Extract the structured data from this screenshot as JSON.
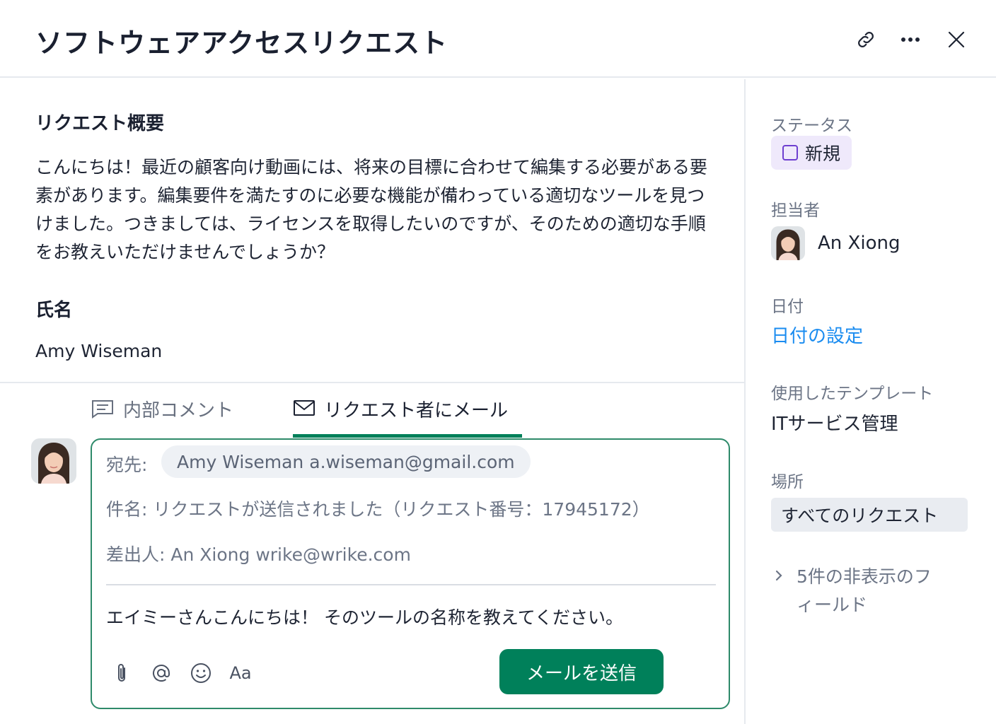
{
  "header": {
    "title": "ソフトウェアアクセスリクエスト",
    "icons": [
      "link-icon",
      "more-icon",
      "close-icon"
    ]
  },
  "request": {
    "summary_label": "リクエスト概要",
    "summary_text": "こんにちは！最近の顧客向け動画には、将来の目標に合わせて編集する必要がある要素があります。編集要件を満たすのに必要な機能が備わっている適切なツールを見つけました。つきましては、ライセンスを取得したいのですが、そのための適切な手順をお教えいただけませんでしょうか？",
    "name_label": "氏名",
    "name_value": "Amy Wiseman"
  },
  "tabs": [
    {
      "label": "内部コメント",
      "icon": "comment-icon",
      "active": false
    },
    {
      "label": "リクエスト者にメール",
      "icon": "mail-icon",
      "active": true
    }
  ],
  "composer": {
    "to_label": "宛先:",
    "to_name": "Amy Wiseman",
    "to_email": "a.wiseman@gmail.com",
    "subject_label": "件名:",
    "subject_value": "リクエストが送信されました（リクエスト番号：17945172）",
    "from_label": "差出人:",
    "from_value": "An Xiong wrike@wrike.com",
    "body": "エイミーさんこんにちは！ そのツールの名称を教えてください。",
    "tools": [
      "paperclip-icon",
      "at-icon",
      "emoji-icon",
      "text-format-icon"
    ],
    "format_label": "Aa",
    "send_label": "メールを送信"
  },
  "sidebar": {
    "status_label": "ステータス",
    "status_value": "新規",
    "status_color": "#6e3fd0",
    "assignee_label": "担当者",
    "assignee_name": "An Xiong",
    "date_label": "日付",
    "date_link": "日付の設定",
    "template_label": "使用したテンプレート",
    "template_value": "ITサービス管理",
    "location_label": "場所",
    "location_value": "すべてのリクエスト",
    "hidden_fields": "5件の非表示のフィールド"
  },
  "colors": {
    "accent": "#00805a",
    "link": "#1a8cf0",
    "status_bg": "#efe9fb"
  }
}
